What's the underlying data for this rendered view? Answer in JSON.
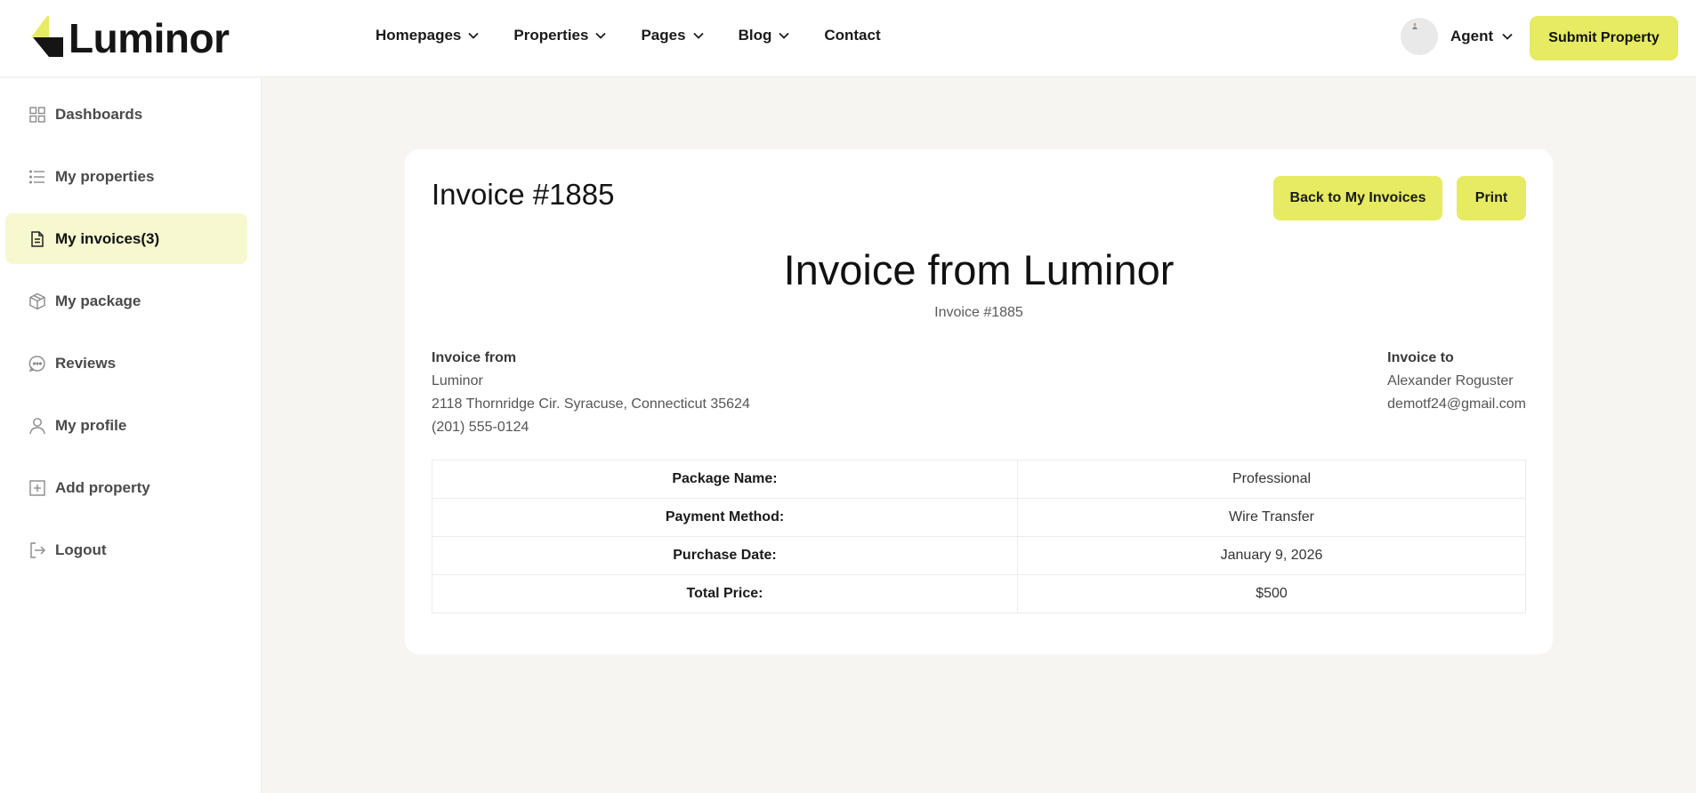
{
  "brand": {
    "name": "Luminor",
    "accent": "#e6eb61",
    "logo_icon": "luminor-logo-icon"
  },
  "nav": [
    {
      "label": "Homepages",
      "dropdown": true
    },
    {
      "label": "Properties",
      "dropdown": true
    },
    {
      "label": "Pages",
      "dropdown": true
    },
    {
      "label": "Blog",
      "dropdown": true
    },
    {
      "label": "Contact",
      "dropdown": false
    }
  ],
  "user": {
    "label": "Agent",
    "avatar_icon": "user-avatar"
  },
  "header": {
    "submit_label": "Submit Property"
  },
  "sidebar": {
    "items": [
      {
        "label": "Dashboards",
        "icon": "grid-icon"
      },
      {
        "label": "My properties",
        "icon": "list-icon"
      },
      {
        "label": "My invoices(3)",
        "icon": "document-icon",
        "active": true
      },
      {
        "label": "My package",
        "icon": "package-icon"
      },
      {
        "label": "Reviews",
        "icon": "chat-icon"
      },
      {
        "label": "My profile",
        "icon": "user-icon"
      },
      {
        "label": "Add property",
        "icon": "plus-square-icon"
      },
      {
        "label": "Logout",
        "icon": "logout-icon"
      }
    ]
  },
  "invoice": {
    "title": "Invoice #1885",
    "back_label": "Back to My Invoices",
    "print_label": "Print",
    "heading": "Invoice from Luminor",
    "subheading": "Invoice #1885",
    "from": {
      "label": "Invoice from",
      "name": "Luminor",
      "address": "2118 Thornridge Cir. Syracuse, Connecticut 35624",
      "phone": "(201) 555-0124"
    },
    "to": {
      "label": "Invoice to",
      "name": "Alexander Roguster",
      "email": "demotf24@gmail.com"
    },
    "rows": [
      {
        "key": "Package Name:",
        "value": "Professional"
      },
      {
        "key": "Payment Method:",
        "value": "Wire Transfer"
      },
      {
        "key": "Purchase Date:",
        "value": "January 9, 2026"
      },
      {
        "key": "Total Price:",
        "value": "$500"
      }
    ]
  }
}
